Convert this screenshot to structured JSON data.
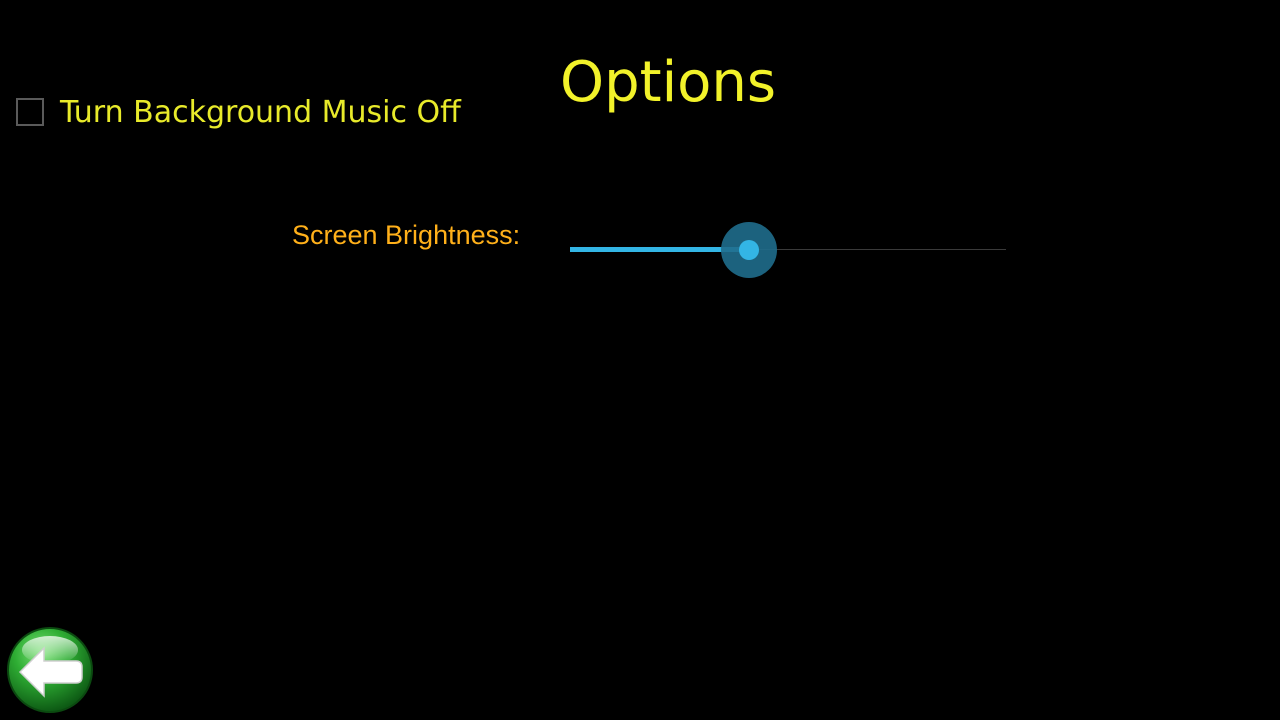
{
  "title": "Options",
  "music_option": {
    "label": "Turn Background Music Off",
    "checked": false
  },
  "brightness": {
    "label": "Screen Brightness:",
    "value_fraction": 0.41
  },
  "back_button": {
    "icon": "back-arrow-icon"
  },
  "colors": {
    "background": "#000000",
    "title": "#f2f22a",
    "checkbox_label": "#e8ea2a",
    "brightness_label": "#ffb01a",
    "slider_accent": "#33b5e5",
    "back_button": "#1f9a2a"
  }
}
